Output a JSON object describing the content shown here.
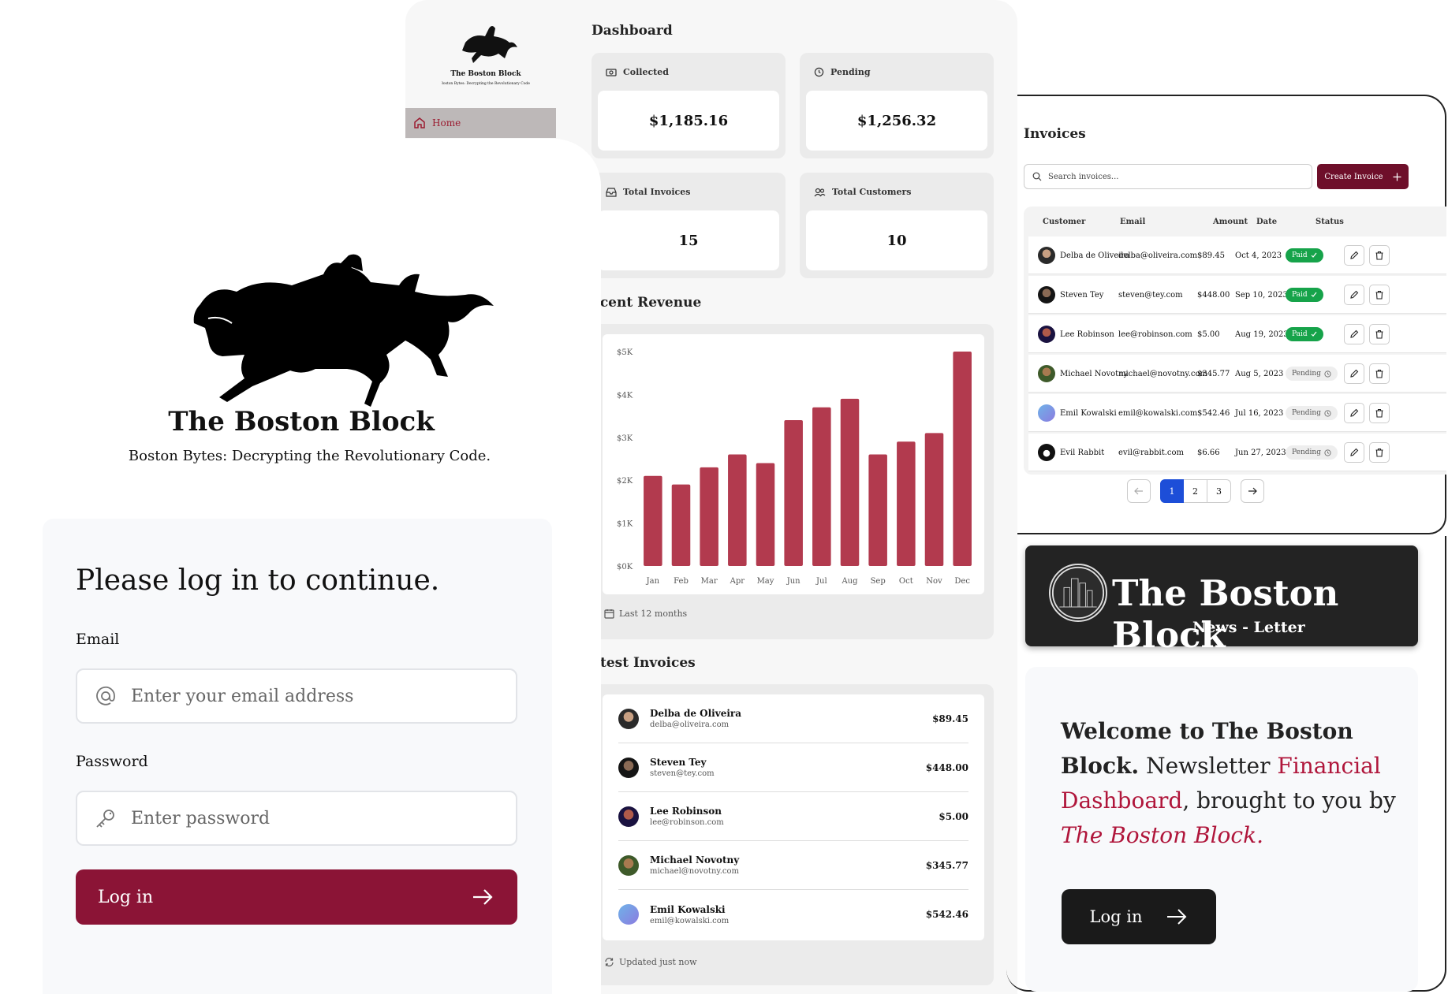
{
  "dashboard": {
    "brand_title": "The Boston Block",
    "brand_sub": "Boston Bytes: Decrypting the Revolutionary Code.",
    "nav_home": "Home",
    "title": "Dashboard",
    "cards": [
      {
        "label": "Collected",
        "value": "$1,185.16",
        "icon": "banknote-icon"
      },
      {
        "label": "Pending",
        "value": "$1,256.32",
        "icon": "clock-icon"
      },
      {
        "label": "Total Invoices",
        "value": "15",
        "icon": "inbox-icon"
      },
      {
        "label": "Total Customers",
        "value": "10",
        "icon": "users-icon"
      }
    ],
    "revenue_title": "ecent Revenue",
    "revenue_footnote": "Last 12 months",
    "latest_title": "atest Invoices",
    "latest_footnote": "Updated just now",
    "latest": [
      {
        "name": "Delba de Oliveira",
        "email": "delba@oliveira.com",
        "amount": "$89.45"
      },
      {
        "name": "Steven Tey",
        "email": "steven@tey.com",
        "amount": "$448.00"
      },
      {
        "name": "Lee Robinson",
        "email": "lee@robinson.com",
        "amount": "$5.00"
      },
      {
        "name": "Michael Novotny",
        "email": "michael@novotny.com",
        "amount": "$345.77"
      },
      {
        "name": "Emil Kowalski",
        "email": "emil@kowalski.com",
        "amount": "$542.46"
      }
    ]
  },
  "chart_data": {
    "type": "bar",
    "categories": [
      "Jan",
      "Feb",
      "Mar",
      "Apr",
      "May",
      "Jun",
      "Jul",
      "Aug",
      "Sep",
      "Oct",
      "Nov",
      "Dec"
    ],
    "values": [
      2100,
      1900,
      2300,
      2600,
      2400,
      3400,
      3700,
      3900,
      2600,
      2900,
      3100,
      5000
    ],
    "y_ticks": [
      "$0K",
      "$1K",
      "$2K",
      "$3K",
      "$4K",
      "$5K"
    ],
    "ylim": [
      0,
      5000
    ],
    "bar_color": "#b23a4e"
  },
  "login": {
    "brand_title": "The Boston Block",
    "brand_sub": "Boston Bytes: Decrypting the Revolutionary Code.",
    "heading": "Please log in to continue.",
    "email_label": "Email",
    "email_placeholder": "Enter your email address",
    "password_label": "Password",
    "password_placeholder": "Enter password",
    "button": "Log in"
  },
  "invoices": {
    "title": "Invoices",
    "search_placeholder": "Search invoices...",
    "create_label": "Create Invoice",
    "columns": [
      "Customer",
      "Email",
      "Amount",
      "Date",
      "Status"
    ],
    "rows": [
      {
        "customer": "Delba de Oliveira",
        "email": "delba@oliveira.com",
        "amount": "$89.45",
        "date": "Oct 4, 2023",
        "status": "Paid"
      },
      {
        "customer": "Steven Tey",
        "email": "steven@tey.com",
        "amount": "$448.00",
        "date": "Sep 10, 2023",
        "status": "Paid"
      },
      {
        "customer": "Lee Robinson",
        "email": "lee@robinson.com",
        "amount": "$5.00",
        "date": "Aug 19, 2023",
        "status": "Paid"
      },
      {
        "customer": "Michael Novotny",
        "email": "michael@novotny.com",
        "amount": "$345.77",
        "date": "Aug 5, 2023",
        "status": "Pending"
      },
      {
        "customer": "Emil Kowalski",
        "email": "emil@kowalski.com",
        "amount": "$542.46",
        "date": "Jul 16, 2023",
        "status": "Pending"
      },
      {
        "customer": "Evil Rabbit",
        "email": "evil@rabbit.com",
        "amount": "$6.66",
        "date": "Jun 27, 2023",
        "status": "Pending"
      }
    ],
    "pages": [
      "1",
      "2",
      "3"
    ],
    "current_page": "1"
  },
  "newsletter": {
    "title": "The Boston Block",
    "subtitle": "News - Letter",
    "welcome_1": "Welcome to The Boston Block.",
    "welcome_2": "Newsletter ",
    "welcome_hl1": "Financial Dashboard",
    "welcome_3": ", brought to you by ",
    "welcome_hl2": "The Boston Block.",
    "button": "Log in"
  },
  "colors": {
    "brand": "#8b1436",
    "chart_bar": "#b23a4e",
    "paid": "#16a34a",
    "banner": "#232323"
  }
}
